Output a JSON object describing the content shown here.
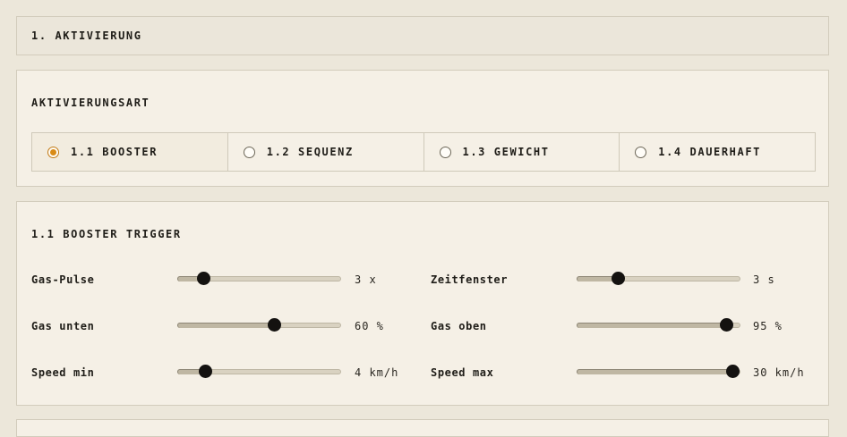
{
  "header": {
    "title": "1. AKTIVIERUNG"
  },
  "mode": {
    "title": "AKTIVIERUNGSART",
    "options": [
      {
        "label": "1.1 BOOSTER",
        "selected": true
      },
      {
        "label": "1.2 SEQUENZ",
        "selected": false
      },
      {
        "label": "1.3 GEWICHT",
        "selected": false
      },
      {
        "label": "1.4 DAUERHAFT",
        "selected": false
      }
    ]
  },
  "trigger": {
    "title": "1.1 BOOSTER TRIGGER",
    "rows": [
      {
        "label": "Gas-Pulse",
        "value": "3 x",
        "level": 0.16
      },
      {
        "label": "Zeitfenster",
        "value": "3 s",
        "level": 0.25
      },
      {
        "label": "Gas unten",
        "value": "60 %",
        "level": 0.59
      },
      {
        "label": "Gas oben",
        "value": "95 %",
        "level": 0.91
      },
      {
        "label": "Speed min",
        "value": "4 km/h",
        "level": 0.17
      },
      {
        "label": "Speed max",
        "value": "30 km/h",
        "level": 0.95
      }
    ]
  },
  "colors": {
    "accent": "#d98b16",
    "thumb": "#141210",
    "panel": "#f5f0e6",
    "background": "#ece7da"
  }
}
